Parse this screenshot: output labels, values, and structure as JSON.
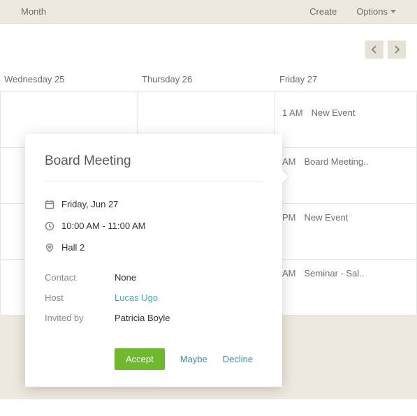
{
  "toolbar": {
    "view_label": "Month",
    "create_label": "Create",
    "options_label": "Options"
  },
  "day_headers": {
    "wed": "Wednesday 25",
    "thu": "Thursday 26",
    "fri": "Friday 27"
  },
  "friday_events": [
    {
      "time": "1 AM",
      "title": "New Event"
    },
    {
      "time": "AM",
      "title": "Board Meeting.."
    },
    {
      "time": "PM",
      "title": "New Event"
    },
    {
      "time": "AM",
      "title": "Seminar - Sal.."
    }
  ],
  "popover": {
    "title": "Board Meeting",
    "date": "Friday, Jun 27",
    "time": "10:00 AM - 11:00 AM",
    "location": "Hall 2",
    "contact_label": "Contact",
    "contact_value": "None",
    "host_label": "Host",
    "host_value": "Lucas Ugo",
    "invited_by_label": "Invited by",
    "invited_by_value": "Patricia Boyle",
    "accept_label": "Accept",
    "maybe_label": "Maybe",
    "decline_label": "Decline"
  }
}
